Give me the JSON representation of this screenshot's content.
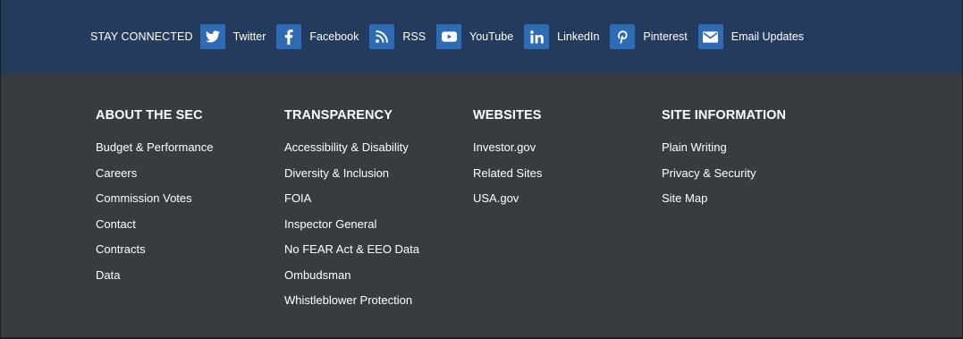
{
  "social": {
    "label": "STAY CONNECTED",
    "icon_bg": "#2f6ab5",
    "bar_bg": "#233b5c",
    "items": [
      {
        "label": "Twitter",
        "icon": "twitter-icon"
      },
      {
        "label": "Facebook",
        "icon": "facebook-icon"
      },
      {
        "label": "RSS",
        "icon": "rss-icon"
      },
      {
        "label": "YouTube",
        "icon": "youtube-icon"
      },
      {
        "label": "LinkedIn",
        "icon": "linkedin-icon"
      },
      {
        "label": "Pinterest",
        "icon": "pinterest-icon"
      },
      {
        "label": "Email Updates",
        "icon": "email-icon"
      }
    ]
  },
  "columns": [
    {
      "title": "ABOUT THE SEC",
      "links": [
        "Budget & Performance",
        "Careers",
        "Commission Votes",
        "Contact",
        "Contracts",
        "Data"
      ]
    },
    {
      "title": "TRANSPARENCY",
      "links": [
        "Accessibility & Disability",
        "Diversity & Inclusion",
        "FOIA",
        "Inspector General",
        "No FEAR Act & EEO Data",
        "Ombudsman",
        "Whistleblower Protection"
      ]
    },
    {
      "title": "WEBSITES",
      "links": [
        "Investor.gov",
        "Related Sites",
        "USA.gov"
      ]
    },
    {
      "title": "SITE INFORMATION",
      "links": [
        "Plain Writing",
        "Privacy & Security",
        "Site Map"
      ]
    }
  ]
}
